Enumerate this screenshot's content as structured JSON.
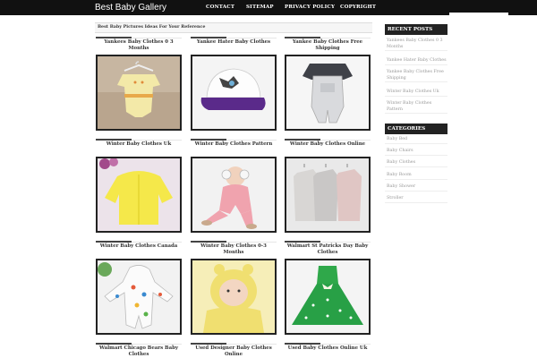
{
  "header": {
    "site_title": "Best Baby Gallery",
    "nav": [
      "CONTACT",
      "SITEMAP",
      "PRIVACY POLICY",
      "COPYRIGHT"
    ]
  },
  "main": {
    "tagline": "Best Baby Pictures Ideas For Your Reference",
    "cards": [
      {
        "title": "Yankees Baby Clothes 0 3 Months",
        "image": "yellow-romper-on-hanger"
      },
      {
        "title": "Yankee Hater Baby Clothes",
        "image": "purple-white-cap"
      },
      {
        "title": "Yankee Baby Clothes Free Shipping",
        "image": "grey-overall-set"
      },
      {
        "title": "Winter Baby Clothes Uk",
        "image": "yellow-knit-sweater"
      },
      {
        "title": "Winter Baby Clothes Pattern",
        "image": "baby-in-pink-snowsuit"
      },
      {
        "title": "Winter Baby Clothes Online",
        "image": "hanging-winter-coats"
      },
      {
        "title": "Winter Baby Clothes Canada",
        "image": "printed-hooded-romper"
      },
      {
        "title": "Winter Baby Clothes 0-3 Months",
        "image": "baby-in-yellow-hood"
      },
      {
        "title": "Walmart St Patricks Day Baby Clothes",
        "image": "green-polka-dot-dress"
      },
      {
        "title": "Walmart Chicago Bears Baby Clothes",
        "image": ""
      },
      {
        "title": "Used Designer Baby Clothes Online",
        "image": ""
      },
      {
        "title": "Used Baby Clothes Online Uk",
        "image": ""
      }
    ]
  },
  "sidebar": {
    "recent_title": "RECENT POSTS",
    "recent": [
      "Yankees Baby Clothes 0 3 Months",
      "Yankee Hater Baby Clothes",
      "Yankee Baby Clothes Free Shipping",
      "Winter Baby Clothes Uk",
      "Winter Baby Clothes Pattern"
    ],
    "categories_title": "CATEGORIES",
    "categories": [
      "Baby Bed",
      "Baby Chairs",
      "Baby Clothes",
      "Baby Room",
      "Baby Shower",
      "Stroller"
    ]
  },
  "colors": {
    "header_bg": "#111111",
    "sidebar_head_bg": "#222222",
    "link_grey": "#999999"
  }
}
